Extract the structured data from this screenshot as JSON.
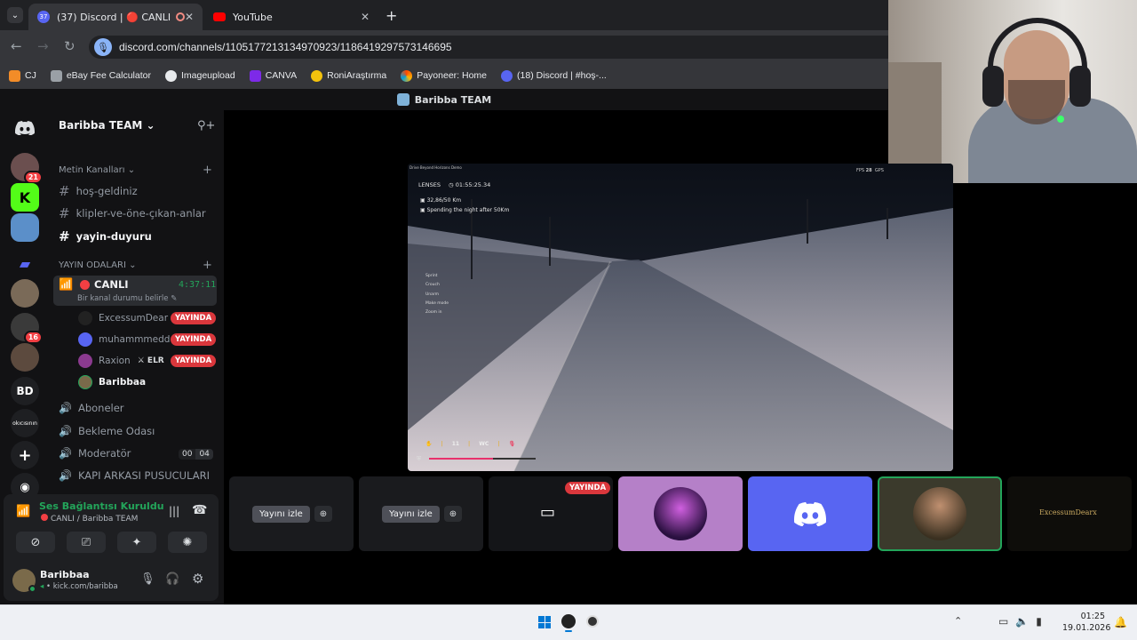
{
  "browser": {
    "tabs": [
      {
        "title": "(37) Discord | 🔴 CANLI | B",
        "badge": "37"
      },
      {
        "title": "YouTube"
      }
    ],
    "url": "discord.com/channels/1105177213134970923/1186419297573146695",
    "bookmarks": [
      "CJ",
      "eBay Fee Calculator",
      "Imageupload",
      "CANVA",
      "RoniAraştırma",
      "Payoneer: Home",
      "(18) Discord | #hoş-..."
    ]
  },
  "discord": {
    "stage_title": "Baribba TEAM",
    "server_name": "Baribba TEAM",
    "guild_labels": {
      "bd": "BD",
      "sm": "okıcısının"
    },
    "guild_badges": {
      "g1": "21",
      "g2": "16"
    },
    "categories": {
      "text": "Metin Kanalları",
      "voice": "YAYIN ODALARI"
    },
    "text_channels": [
      "hoş-geldiniz",
      "klipler-ve-öne-çıkan-anlar",
      "yayin-duyuru"
    ],
    "live_channel": {
      "name": "CANLI",
      "timer": "4:37:11",
      "status": "Bir kanal durumu belirle"
    },
    "users": [
      {
        "name": "ExcessumDear",
        "live": "YAYINDA"
      },
      {
        "name": "muhammmedd",
        "live": "YAYINDA"
      },
      {
        "name": "Raxion",
        "tag": "ELR",
        "live": "YAYINDA"
      },
      {
        "name": "Baribbaa"
      }
    ],
    "voice_channels": [
      "Aboneler",
      "Bekleme Odası",
      "Moderatör",
      "KAPI ARKASI PUSUCULARI"
    ],
    "moderator_counts": [
      "00",
      "04"
    ],
    "voice_status": {
      "title": "Ses Bağlantısı Kuruldu",
      "subtitle": "CANLI / Baribba TEAM"
    },
    "account": {
      "name": "Baribbaa",
      "status": "kick.com/baribba"
    },
    "tiles": {
      "watch_label": "Yayını izle",
      "live_badge": "YAYINDA",
      "ex_logo": "ExcessumDearx"
    }
  },
  "game": {
    "title_strip": "Drive Beyond Horizons Demo",
    "fps_label": "FPS",
    "fps_value": "28",
    "fps_tail": "GPS",
    "lenses": "LENSES",
    "clock": "01:55:25.34",
    "objective1": "32,86/50 Km",
    "objective2": "Spending the night after 50Km",
    "controls": [
      "Sprint",
      "Crouch",
      "Unarm",
      "Make mode",
      "Zoom in"
    ],
    "hud": {
      "a": "11",
      "b": "WC"
    },
    "progress": 0.6
  },
  "taskbar": {
    "time": "01:25",
    "date": "19.01.2026"
  }
}
